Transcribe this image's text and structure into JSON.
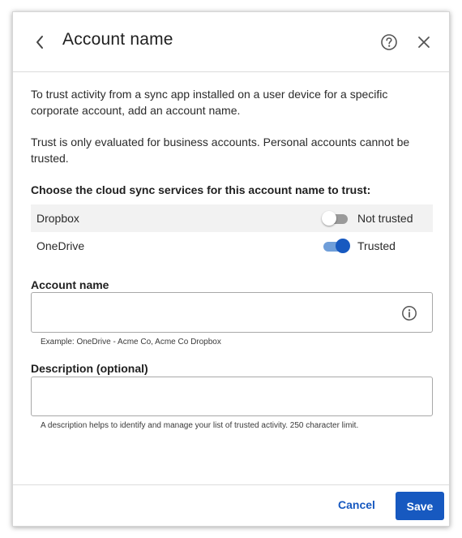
{
  "dialog": {
    "title": "Account name",
    "back_icon": "chevron-left-icon",
    "help_icon": "question-circle-icon",
    "close_icon": "close-icon"
  },
  "intro": {
    "paragraph_1": "To trust activity from a sync app installed on a user device for a specific corporate account, add an account name.",
    "paragraph_2": "Trust is only evaluated for business accounts. Personal accounts cannot be trusted."
  },
  "services": {
    "heading": "Choose the cloud sync services for this account name to trust:",
    "items": [
      {
        "name": "Dropbox",
        "trusted": false,
        "status": "Not trusted"
      },
      {
        "name": "OneDrive",
        "trusted": true,
        "status": "Trusted"
      }
    ]
  },
  "account_name": {
    "label": "Account name",
    "value": "",
    "placeholder": "",
    "hint": "Example: OneDrive - Acme Co, Acme Co Dropbox",
    "info_icon": "info-circle-icon"
  },
  "description": {
    "label": "Description (optional)",
    "value": "",
    "placeholder": "",
    "hint": "A description helps to identify and manage your list of trusted activity. 250 character limit."
  },
  "footer": {
    "cancel_label": "Cancel",
    "save_label": "Save"
  },
  "colors": {
    "accent": "#1759c0",
    "toggle_on_track": "#6f9ed9",
    "toggle_off_track": "#9a9a9a",
    "row_shade": "#f2f2f2"
  }
}
